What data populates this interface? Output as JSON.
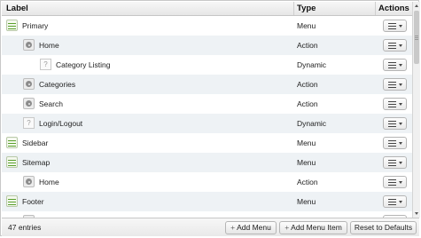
{
  "columns": {
    "label": "Label",
    "type": "Type",
    "actions": "Actions"
  },
  "rows": [
    {
      "label": "Primary",
      "type": "Menu",
      "icon": "menu-icon",
      "indent": 0
    },
    {
      "label": "Home",
      "type": "Action",
      "icon": "gear-icon",
      "indent": 1
    },
    {
      "label": "Category Listing",
      "type": "Dynamic",
      "icon": "question-icon",
      "indent": 2
    },
    {
      "label": "Categories",
      "type": "Action",
      "icon": "gear-icon",
      "indent": 1
    },
    {
      "label": "Search",
      "type": "Action",
      "icon": "gear-icon",
      "indent": 1
    },
    {
      "label": "Login/Logout",
      "type": "Dynamic",
      "icon": "question-icon",
      "indent": 1
    },
    {
      "label": "Sidebar",
      "type": "Menu",
      "icon": "menu-icon",
      "indent": 0
    },
    {
      "label": "Sitemap",
      "type": "Menu",
      "icon": "menu-icon",
      "indent": 0
    },
    {
      "label": "Home",
      "type": "Action",
      "icon": "gear-icon",
      "indent": 1
    },
    {
      "label": "Footer",
      "type": "Menu",
      "icon": "menu-icon",
      "indent": 0
    },
    {
      "label": "",
      "type": "",
      "icon": "gear-icon",
      "indent": 1
    }
  ],
  "footer": {
    "entries": "47 entries",
    "add_menu": "Add Menu",
    "add_menu_item": "Add Menu Item",
    "reset": "Reset to Defaults"
  },
  "colors": {
    "alt_row": "#eef2f5",
    "menu_icon": "#5aa02c"
  }
}
